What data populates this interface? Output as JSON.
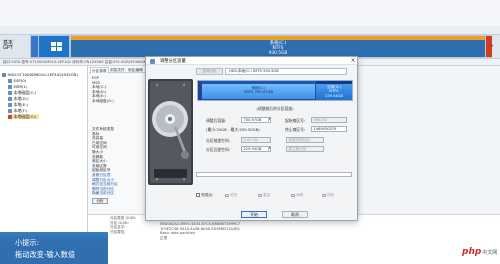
{
  "disk_bar": {
    "label": "基本\nGPT",
    "partition_label": "系统(C:)",
    "partition_fs": "NTFS",
    "partition_size": "930.5GB",
    "info": "接口:SATA  型号:ST1000DM010-2EP102  序列号:ZN1ZX96X  容量:931.5GB(953869MB)  柱面数:121601  磁头数:255  每道扇区数:63  总扇区数:1953525168"
  },
  "tree": {
    "items": [
      {
        "label": "HD0:ST1000DM010-2EP102(932GB)",
        "icon": "disk-icon"
      },
      {
        "label": "ESP(0)",
        "icon": "partition-icon"
      },
      {
        "label": "MSR(1)",
        "icon": "partition-icon"
      },
      {
        "label": "本地磁盘(C:)",
        "icon": "partition-icon"
      },
      {
        "label": "本地(D:)",
        "icon": "partition-icon"
      },
      {
        "label": "本地(E:)",
        "icon": "partition-icon"
      },
      {
        "label": "本地(F:)",
        "icon": "partition-icon"
      },
      {
        "label": "本地磁盘(G:)",
        "icon": "partition-icon",
        "selected": true
      }
    ]
  },
  "props": {
    "tabs": [
      "分区参数",
      "浏览文件",
      "扇区编辑"
    ],
    "rows": [
      "ESP",
      "MSR",
      "本地(C:)",
      "本地(D:)",
      "本地(E:)",
      "本地磁盘(G:)"
    ],
    "ops": [
      "文件系统类型",
      "卷标",
      "总容量",
      "已用空间",
      "可用空间",
      "簇大小",
      "总簇数",
      "扇区大小",
      "总扇区数",
      "起始扇区号"
    ],
    "links": [
      "查看分区表",
      "调整分区大小",
      "格式化当前分区",
      "删除当前分区",
      "隐藏当前分区"
    ],
    "prev_button": "分析",
    "bottom_left": [
      "分区类型 GUID:",
      "分区 GUID:",
      "分区名字:",
      "分区属性:"
    ],
    "bottom_right": [
      "EBD0A0A2-B9E5-4433-87C0-68B6B72699C7",
      "1F0E2C48-0A1A-4a2B-8e3A-5D9E8D12A4B1",
      "Basic data partition",
      "正常"
    ]
  },
  "dialog": {
    "title": "调整分区容量",
    "close": "×",
    "prev_partition_button": "选择分区",
    "disk_selector": "HD0:本地(C:) NTFS 930.5GB",
    "partition_main_label": "系统(C:)",
    "partition_main_fs": "NTFS 700.97GB",
    "partition_free_label": "空闲(G:)",
    "partition_free_fs": "NTFS",
    "partition_free_size": "229.54GB",
    "hint": "(调整前后的分区容量)",
    "fields": {
      "new_size_label": "调整后容量:",
      "new_size_value": "700.97GB",
      "new_size_detail": "(最小:20GB - 最大:930.50GB)",
      "start_sector_label": "起始扇区号:",
      "start_sector_value": "968192",
      "end_sector_label": "终止扇区号:",
      "end_sector_value": "1469030379",
      "front_free_label": "分区前部空间:",
      "front_free_value": "0.00 GB",
      "front_free_right_label": "前部空闲分区",
      "back_free_label": "分区后部空间:",
      "back_free_value": "229.54GB",
      "back_free_right_label": "建立新分区"
    },
    "advanced_checkbox": "完成后:",
    "options": [
      "关机",
      "重启",
      "休眠",
      "待机"
    ],
    "start_button": "开始",
    "cancel_button": "取消"
  },
  "tip": {
    "title": "小提示:",
    "text": "拖动改变-输入数值"
  },
  "watermark": {
    "logo": "php",
    "suffix": "中文网"
  },
  "colors": {
    "partition_blue": "#2f6fb0",
    "partition_orange": "#f0a020",
    "tip_bg": "#2f6fb0",
    "watermark_red": "#d7282f"
  }
}
